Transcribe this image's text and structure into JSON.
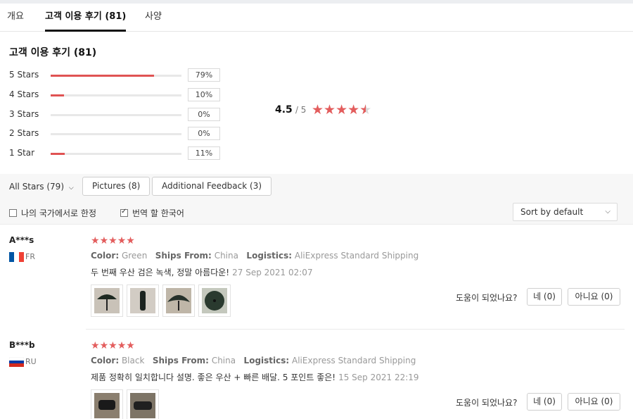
{
  "tabs": [
    {
      "label": "개요"
    },
    {
      "label": "고객 이용 후기 (81)"
    },
    {
      "label": "사양"
    }
  ],
  "summary": {
    "title": "고객 이용 후기 (81)",
    "distribution": [
      {
        "label": "5 Stars",
        "percent": "79%",
        "fraction": 0.79
      },
      {
        "label": "4 Stars",
        "percent": "10%",
        "fraction": 0.1
      },
      {
        "label": "3 Stars",
        "percent": "0%",
        "fraction": 0.0
      },
      {
        "label": "2 Stars",
        "percent": "0%",
        "fraction": 0.0
      },
      {
        "label": "1 Star",
        "percent": "11%",
        "fraction": 0.11
      }
    ],
    "average": "4.5",
    "average_max": "/ 5",
    "average_rating": 4.5
  },
  "filters": {
    "star_filter": "All Stars (79)",
    "pictures": "Pictures (8)",
    "additional": "Additional Feedback (3)",
    "my_country_only": "나의 국가에서로 한정",
    "my_country_checked": false,
    "translate": "번역 할 한국어",
    "translate_checked": true,
    "sort": "Sort by default"
  },
  "helpful_prompt": "도움이 되었나요?",
  "reviews": [
    {
      "user": "A***s",
      "country": "FR",
      "rating": 5,
      "color_label": "Color:",
      "color_value": "Green",
      "ships_label": "Ships From:",
      "ships_value": "China",
      "logistics_label": "Logistics:",
      "logistics_value": "AliExpress Standard Shipping",
      "text": "두 번째 우산 검은 녹색, 정말 아름다운!",
      "date": "27 Sep 2021 02:07",
      "yes": "네 (0)",
      "no": "아니요 (0)"
    },
    {
      "user": "B***b",
      "country": "RU",
      "rating": 5,
      "color_label": "Color:",
      "color_value": "Black",
      "ships_label": "Ships From:",
      "ships_value": "China",
      "logistics_label": "Logistics:",
      "logistics_value": "AliExpress Standard Shipping",
      "text": "제품 정확히 일치합니다 설명. 좋은 우산 + 빠른 배달. 5 포인트 좋은!",
      "date": "15 Sep 2021 22:19",
      "yes": "네 (0)",
      "no": "아니요 (0)"
    }
  ],
  "colors": {
    "accent_red": "#e05353",
    "star_red": "#e35d5d",
    "flag_fr_blue": "#0055a4",
    "flag_fr_red": "#ef4135",
    "flag_ru_blue": "#0039a6",
    "flag_ru_red": "#d52b1e"
  }
}
